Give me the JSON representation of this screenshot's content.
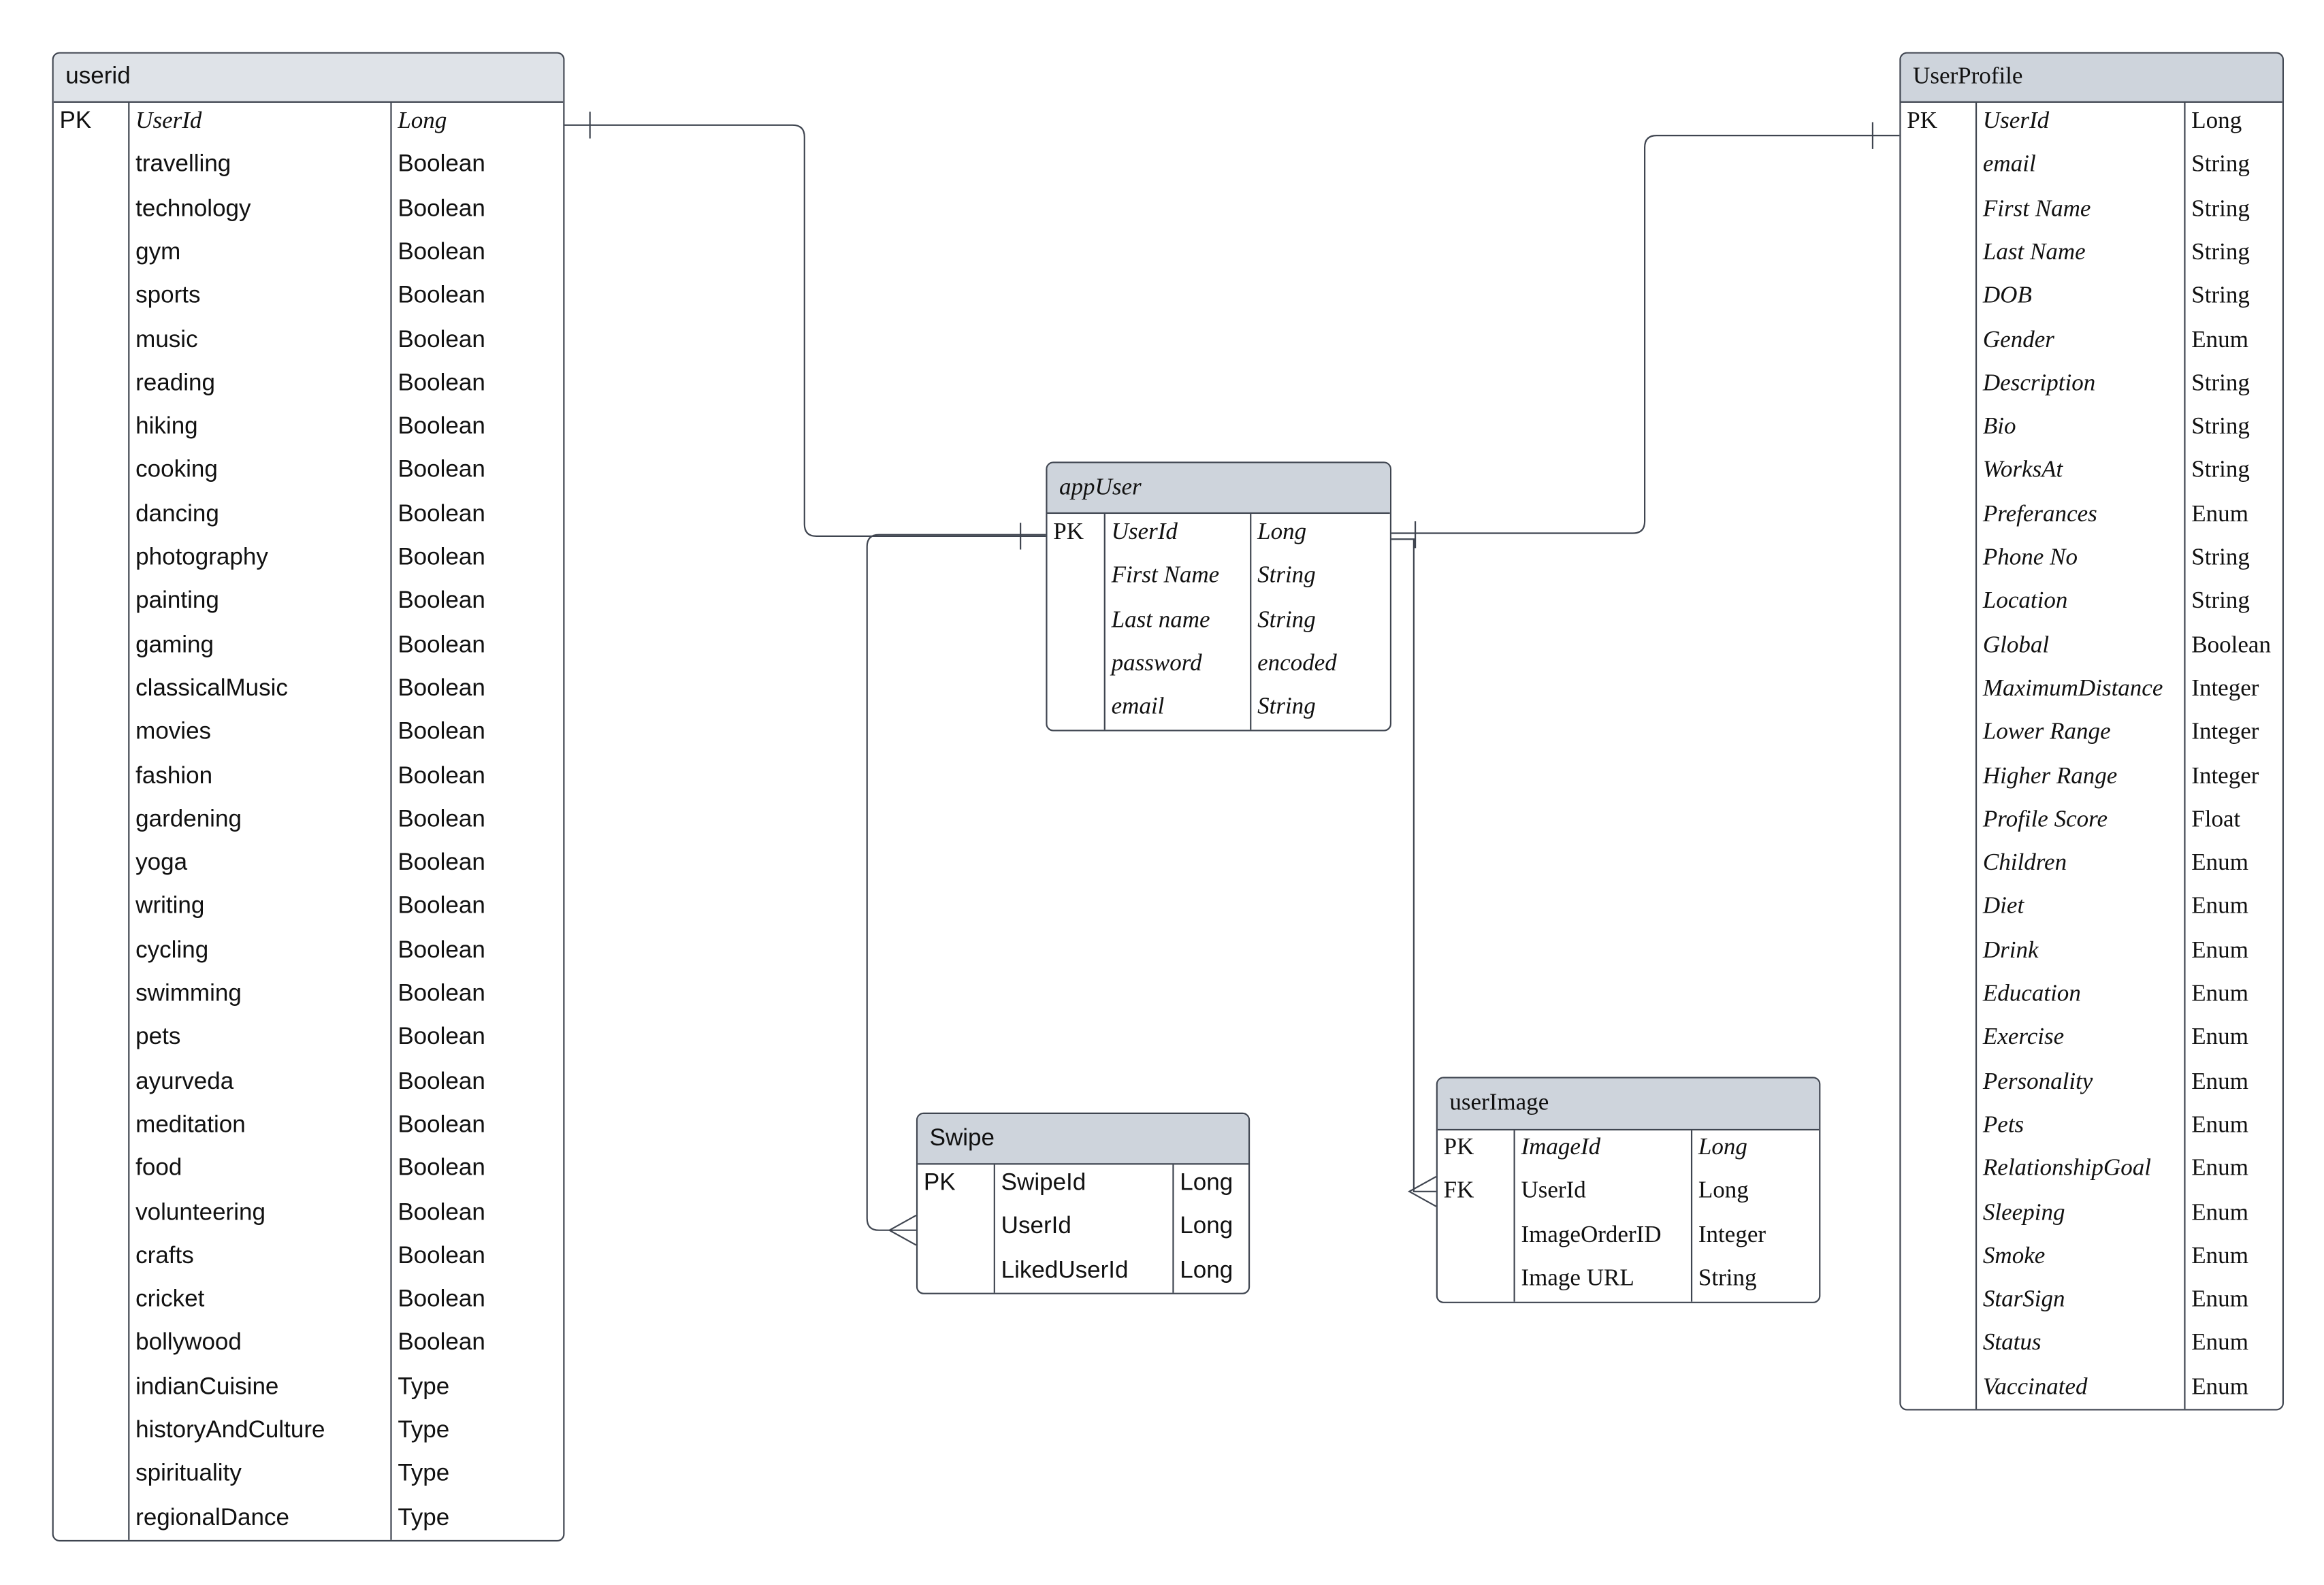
{
  "entities": {
    "userid": {
      "title": "userid",
      "header_color": "#dfe3e8",
      "rows": [
        [
          "PK",
          "UserId",
          "Long"
        ],
        [
          "",
          "travelling",
          "Boolean"
        ],
        [
          "",
          "technology",
          "Boolean"
        ],
        [
          "",
          "gym",
          "Boolean"
        ],
        [
          "",
          "sports",
          "Boolean"
        ],
        [
          "",
          "music",
          "Boolean"
        ],
        [
          "",
          "reading",
          "Boolean"
        ],
        [
          "",
          "hiking",
          "Boolean"
        ],
        [
          "",
          "cooking",
          "Boolean"
        ],
        [
          "",
          "dancing",
          "Boolean"
        ],
        [
          "",
          "photography",
          "Boolean"
        ],
        [
          "",
          "painting",
          "Boolean"
        ],
        [
          "",
          "gaming",
          "Boolean"
        ],
        [
          "",
          "classicalMusic",
          "Boolean"
        ],
        [
          "",
          "movies",
          "Boolean"
        ],
        [
          "",
          "fashion",
          "Boolean"
        ],
        [
          "",
          "gardening",
          "Boolean"
        ],
        [
          "",
          "yoga",
          "Boolean"
        ],
        [
          "",
          "writing",
          "Boolean"
        ],
        [
          "",
          "cycling",
          "Boolean"
        ],
        [
          "",
          "swimming",
          "Boolean"
        ],
        [
          "",
          "pets",
          "Boolean"
        ],
        [
          "",
          "ayurveda",
          "Boolean"
        ],
        [
          "",
          "meditation",
          "Boolean"
        ],
        [
          "",
          "food",
          "Boolean"
        ],
        [
          "",
          "volunteering",
          "Boolean"
        ],
        [
          "",
          "crafts",
          "Boolean"
        ],
        [
          "",
          "cricket",
          "Boolean"
        ],
        [
          "",
          "bollywood",
          "Boolean"
        ],
        [
          "",
          "indianCuisine",
          "Type"
        ],
        [
          "",
          "historyAndCulture",
          "Type"
        ],
        [
          "",
          "spirituality",
          "Type"
        ],
        [
          "",
          "regionalDance",
          "Type"
        ]
      ]
    },
    "userProfile": {
      "title": "UserProfile",
      "header_color": "#ced4dc",
      "rows": [
        [
          "PK",
          "UserId",
          "Long"
        ],
        [
          "",
          "email",
          "String"
        ],
        [
          "",
          "First Name",
          "String"
        ],
        [
          "",
          "Last Name",
          "String"
        ],
        [
          "",
          "DOB",
          "String"
        ],
        [
          "",
          "Gender",
          "Enum"
        ],
        [
          "",
          "Description",
          "String"
        ],
        [
          "",
          "Bio",
          "String"
        ],
        [
          "",
          "WorksAt",
          "String"
        ],
        [
          "",
          "Preferances",
          "Enum"
        ],
        [
          "",
          "Phone No",
          "String"
        ],
        [
          "",
          "Location",
          "String"
        ],
        [
          "",
          "Global",
          "Boolean"
        ],
        [
          "",
          "MaximumDistance",
          "Integer"
        ],
        [
          "",
          "Lower Range",
          "Integer"
        ],
        [
          "",
          "Higher Range",
          "Integer"
        ],
        [
          "",
          "Profile Score",
          "Float"
        ],
        [
          "",
          "Children",
          "Enum"
        ],
        [
          "",
          "Diet",
          "Enum"
        ],
        [
          "",
          "Drink",
          "Enum"
        ],
        [
          "",
          "Education",
          "Enum"
        ],
        [
          "",
          "Exercise",
          "Enum"
        ],
        [
          "",
          "Personality",
          "Enum"
        ],
        [
          "",
          "Pets",
          "Enum"
        ],
        [
          "",
          "RelationshipGoal",
          "Enum"
        ],
        [
          "",
          "Sleeping",
          "Enum"
        ],
        [
          "",
          "Smoke",
          "Enum"
        ],
        [
          "",
          "StarSign",
          "Enum"
        ],
        [
          "",
          "Status",
          "Enum"
        ],
        [
          "",
          "Vaccinated",
          "Enum"
        ]
      ]
    },
    "appUser": {
      "title": "appUser",
      "header_color": "#ced4dc",
      "rows": [
        [
          "PK",
          "UserId",
          "Long"
        ],
        [
          "",
          "First Name",
          "String"
        ],
        [
          "",
          "Last name",
          "String"
        ],
        [
          "",
          "password",
          "encoded"
        ],
        [
          "",
          "email",
          "String"
        ]
      ]
    },
    "swipe": {
      "title": "Swipe",
      "header_color": "#ced4dc",
      "rows": [
        [
          "PK",
          "SwipeId",
          "Long"
        ],
        [
          "",
          "UserId",
          "Long"
        ],
        [
          "",
          "LikedUserId",
          "Long"
        ]
      ]
    },
    "userImage": {
      "title": "userImage",
      "header_color": "#ced4dc",
      "rows": [
        [
          "PK",
          "ImageId",
          "Long"
        ],
        [
          "FK",
          "UserId",
          "Long"
        ],
        [
          "",
          "ImageOrderID",
          "Integer"
        ],
        [
          "",
          "Image URL",
          "String"
        ]
      ]
    }
  },
  "relationships": [
    {
      "from": "userid",
      "to": "appUser",
      "type": "one-to-one"
    },
    {
      "from": "userProfile",
      "to": "appUser",
      "type": "one-to-one"
    },
    {
      "from": "appUser",
      "to": "swipe",
      "type": "one-to-many"
    },
    {
      "from": "appUser",
      "to": "userImage",
      "type": "one-to-many"
    }
  ]
}
